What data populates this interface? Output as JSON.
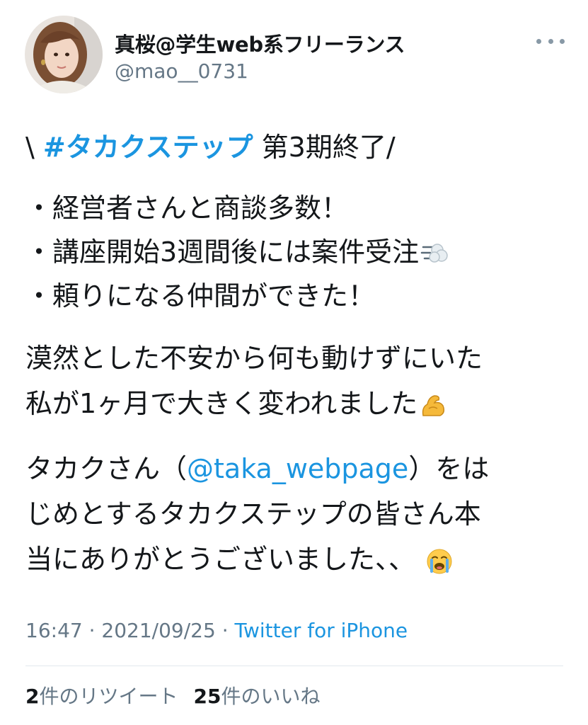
{
  "author": {
    "display_name": "真桜@学生web系フリーランス",
    "handle": "@mao__0731"
  },
  "tweet": {
    "line1_prefix": "\\ ",
    "hashtag": "#タカクステップ",
    "line1_suffix": " 第3期終了/",
    "bullets": [
      "・経営者さんと商談多数！",
      "・講座開始3週間後には案件受注",
      "・頼りになる仲間ができた！"
    ],
    "para2_line1": "漠然とした不安から何も動けずにいた",
    "para2_line2": "私が1ヶ月で大きく変われました",
    "para3_prefix": "タカクさん（",
    "mention": "@taka_webpage",
    "para3_suffix": "）をは",
    "para3_line2": "じめとするタカクステップの皆さん本",
    "para3_line3": "当にありがとうございました、、"
  },
  "meta": {
    "time": "16:47",
    "separator": " · ",
    "date": "2021/09/25",
    "source": "Twitter for iPhone"
  },
  "stats": {
    "retweets_count": "2",
    "retweets_label": "件のリツイート",
    "likes_count": "25",
    "likes_label": "件のいいね"
  },
  "emojis": [
    "dash-emoji",
    "flexed-biceps-emoji",
    "loudly-crying-face-emoji"
  ],
  "colors": {
    "link": "#1b95e0",
    "text": "#14171a",
    "secondary": "#657786",
    "divider": "#e1e8ed"
  }
}
